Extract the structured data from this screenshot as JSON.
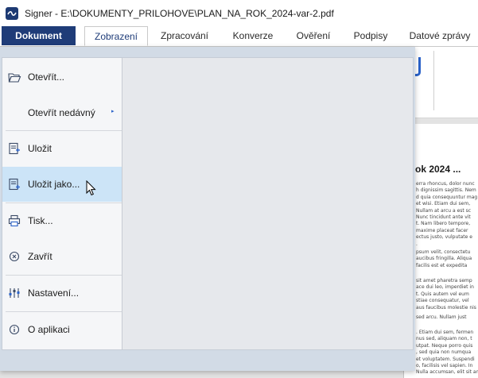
{
  "window": {
    "title": "Signer - E:\\DOKUMENTY_PRILOHOVE\\PLAN_NA_ROK_2024-var-2.pdf"
  },
  "ribbon": {
    "tabs": [
      {
        "label": "Dokument"
      },
      {
        "label": "Zobrazení"
      },
      {
        "label": "Zpracování"
      },
      {
        "label": "Konverze"
      },
      {
        "label": "Ověření"
      },
      {
        "label": "Podpisy"
      },
      {
        "label": "Datové zprávy"
      }
    ],
    "active_tab": "Zobrazení",
    "open_menu": "Dokument"
  },
  "file_menu": {
    "items": [
      {
        "label": "Otevřít...",
        "icon": "folder-open-icon"
      },
      {
        "label": "Otevřít nedávný",
        "icon": "",
        "submenu": true
      },
      {
        "label": "Uložit",
        "icon": "save-icon"
      },
      {
        "label": "Uložit jako...",
        "icon": "save-as-icon",
        "hovered": true
      },
      {
        "label": "Tisk...",
        "icon": "print-icon"
      },
      {
        "label": "Zavřít",
        "icon": "close-circle-icon"
      },
      {
        "label": "Nastavení...",
        "icon": "settings-sliders-icon"
      },
      {
        "label": "O aplikaci",
        "icon": "info-icon"
      }
    ],
    "submenu_arrow": "▸"
  },
  "document_preview": {
    "heading": "ok 2024 ...",
    "paragraphs": [
      [
        "erra rhoncus, dolor nunc",
        "h dignissim sagittis. Nem",
        "d quia consequuntur mag",
        "et wisi. Etiam dui sem,",
        "Nullam at arcu a est sc",
        "Nunc tincidunt ante vit",
        "t. Nam libero tempore,",
        "maxime placeat facer",
        "ectus justo, vulputate e",
        "."
      ],
      [
        "psum velit, consectetu",
        "aucibus fringilla. Aliqua",
        "facilis est et expedita"
      ],
      [
        "sit amet pharetra semp",
        "ace dui leo, imperdiet in",
        "t. Quis autem vel eum",
        "stiae consequatur, vel",
        "aus faucibus molestie nis"
      ],
      [
        "sed arcu. Nullam just"
      ],
      [
        ". Etiam dui sem, fermen",
        "nus sed, aliquam non, t",
        "utpat. Neque porro quis",
        ", sed quia non numqua",
        "et voluptatem. Suspendi",
        "o, facilisis vel sapien. In",
        "Nulla accumsan, elit sit amet varius semper, nulla mau"
      ]
    ]
  },
  "colors": {
    "accent": "#1f3c78",
    "menu_hover": "#cce4f7",
    "icon_blue": "#2a62c9"
  }
}
